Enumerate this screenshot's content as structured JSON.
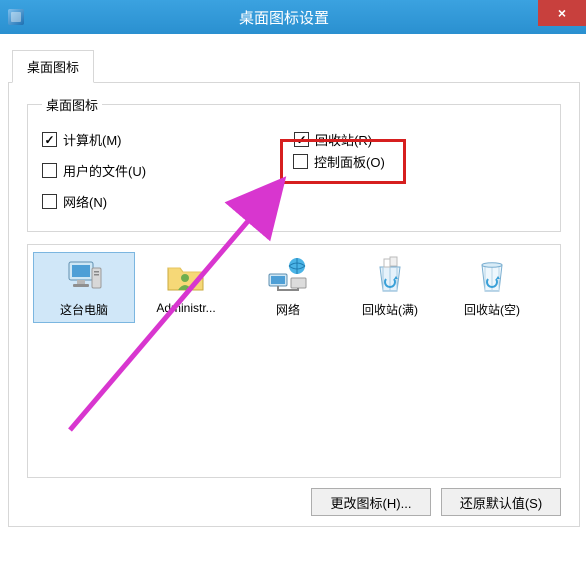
{
  "window": {
    "title": "桌面图标设置",
    "close": "×"
  },
  "tab": {
    "label": "桌面图标"
  },
  "group": {
    "legend": "桌面图标",
    "items": {
      "computer": {
        "label": "计算机(M)",
        "checked": true
      },
      "recycle": {
        "label": "回收站(R)",
        "checked": true
      },
      "userfiles": {
        "label": "用户的文件(U)",
        "checked": false
      },
      "control": {
        "label": "控制面板(O)",
        "checked": false
      },
      "network": {
        "label": "网络(N)",
        "checked": false
      }
    }
  },
  "icons": {
    "thispc": {
      "label": "这台电脑"
    },
    "admin": {
      "label": "Administr..."
    },
    "network": {
      "label": "网络"
    },
    "recyclef": {
      "label": "回收站(满)"
    },
    "recyclee": {
      "label": "回收站(空)"
    }
  },
  "buttons": {
    "change": "更改图标(H)...",
    "restore": "还原默认值(S)"
  },
  "colors": {
    "accent": "#2a90d0",
    "highlight": "#d61f1f",
    "arrow": "#d836cf"
  }
}
